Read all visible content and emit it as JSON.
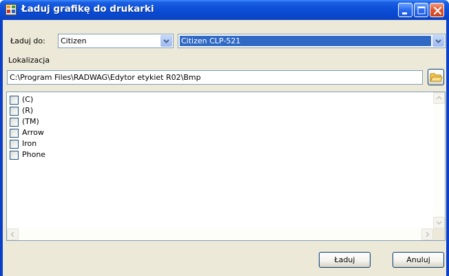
{
  "window": {
    "title": "Ładuj grafikę do drukarki",
    "colors": {
      "title_bar": "#0a49d0",
      "client_bg": "#ece9d8",
      "selection": "#316ac5"
    }
  },
  "target": {
    "label": "Ładuj do:",
    "printer_family": "Citizen",
    "arrow": "->",
    "printer_model": "Citizen CLP-521"
  },
  "location": {
    "label": "Lokalizacja",
    "path": "C:\\Program Files\\RADWAG\\Edytor etykiet R02\\Bmp"
  },
  "graphics_list": {
    "items": [
      {
        "label": "(C)",
        "checked": false
      },
      {
        "label": "(R)",
        "checked": false
      },
      {
        "label": "(TM)",
        "checked": false
      },
      {
        "label": "Arrow",
        "checked": false
      },
      {
        "label": "Iron",
        "checked": false
      },
      {
        "label": "Phone",
        "checked": false
      }
    ]
  },
  "buttons": {
    "load": "Ładuj",
    "cancel": "Anuluj"
  },
  "icons": {
    "app": "app-icon",
    "minimize": "minimize-icon",
    "maximize": "maximize-icon",
    "close": "close-icon",
    "browse": "folder-icon"
  }
}
